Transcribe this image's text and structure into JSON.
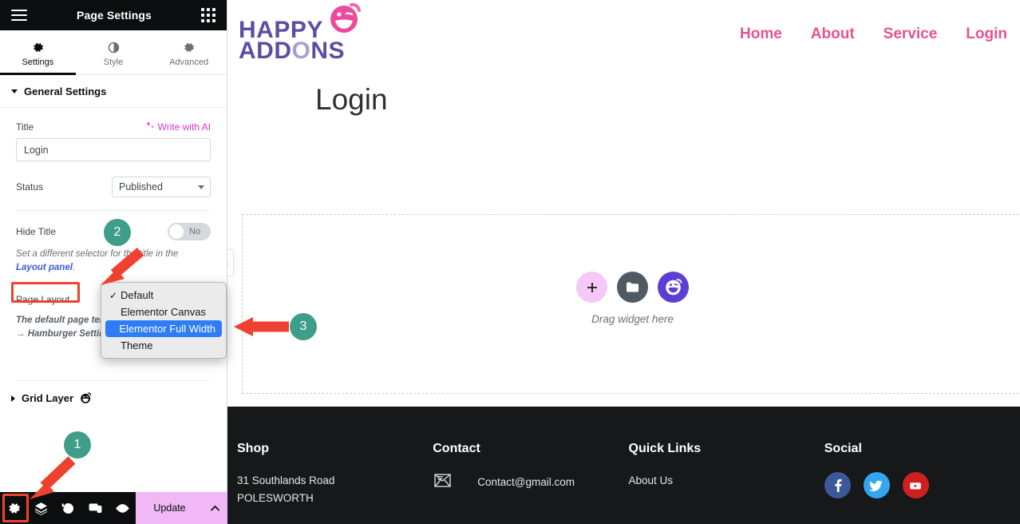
{
  "panel": {
    "title": "Page Settings",
    "menu_icon": "hamburger-icon",
    "apps_icon": "apps-grid-icon",
    "tabs": [
      {
        "label": "Settings",
        "icon": "gear-icon",
        "active": true
      },
      {
        "label": "Style",
        "icon": "contrast-icon",
        "active": false
      },
      {
        "label": "Advanced",
        "icon": "gear-icon",
        "active": false
      }
    ],
    "general_settings": {
      "section_label": "General Settings",
      "title_label": "Title",
      "ai_link_label": "Write with AI",
      "title_value": "Login",
      "status_label": "Status",
      "status_value": "Published",
      "hide_title_label": "Hide Title",
      "hide_title_value": "No",
      "hide_title_hint_pre": "Set a different selector for the title in the ",
      "hide_title_hint_link": "Layout panel",
      "hide_title_hint_post": ".",
      "page_layout_label": "Page Layout",
      "page_layout_hint": "The default page template Elementor Panel → Hamburger Settings."
    },
    "grid_layer": {
      "label": "Grid Layer",
      "icon": "happy-face-icon"
    },
    "layout_menu": {
      "options": [
        {
          "label": "Default",
          "checked": true,
          "selected": false
        },
        {
          "label": "Elementor Canvas",
          "checked": false,
          "selected": false
        },
        {
          "label": "Elementor Full Width",
          "checked": false,
          "selected": true
        },
        {
          "label": "Theme",
          "checked": false,
          "selected": false
        }
      ]
    },
    "bottom_bar": {
      "icons": [
        "gear-icon",
        "layers-icon",
        "history-icon",
        "responsive-icon",
        "preview-eye-icon"
      ],
      "update_label": "Update",
      "caret_icon": "chevron-up-icon"
    },
    "collapse_icon": "chevron-left-icon"
  },
  "site": {
    "logo": {
      "line1": "HAPPY",
      "line2": "ADDONS",
      "icon": "happy-face-icon"
    },
    "nav": [
      {
        "label": "Home"
      },
      {
        "label": "About"
      },
      {
        "label": "Service"
      },
      {
        "label": "Login"
      }
    ],
    "page_title": "Login",
    "dropzone": {
      "add_icon": "plus-icon",
      "folder_icon": "folder-icon",
      "happy_icon": "happy-addons-icon",
      "text": "Drag widget here"
    },
    "footer": {
      "columns": [
        {
          "heading": "Shop",
          "lines": [
            "31 Southlands Road",
            "POLESWORTH"
          ]
        },
        {
          "heading": "Contact",
          "email": "Contact@gmail.com",
          "icon": "envelope-icon"
        },
        {
          "heading": "Quick Links",
          "links": [
            "About Us"
          ]
        },
        {
          "heading": "Social",
          "socials": [
            {
              "name": "facebook-icon",
              "color": "#3b5998"
            },
            {
              "name": "twitter-icon",
              "color": "#34a6ef"
            },
            {
              "name": "youtube-icon",
              "color": "#cd201f"
            }
          ]
        }
      ]
    }
  },
  "annotations": {
    "badges": [
      {
        "num": "1"
      },
      {
        "num": "2"
      },
      {
        "num": "3"
      }
    ],
    "badge_color": "#3e9e8a",
    "arrow_color": "#ef4130",
    "highlight_color": "#ef4130"
  },
  "colors": {
    "panel_dark": "#0c0d0e",
    "nav_pink": "#e8528f",
    "logo_purple": "#5a4fa3",
    "accent_purple": "#5b3fd4",
    "update_pink": "#f0b8f5",
    "select_blue": "#2f7df6"
  }
}
